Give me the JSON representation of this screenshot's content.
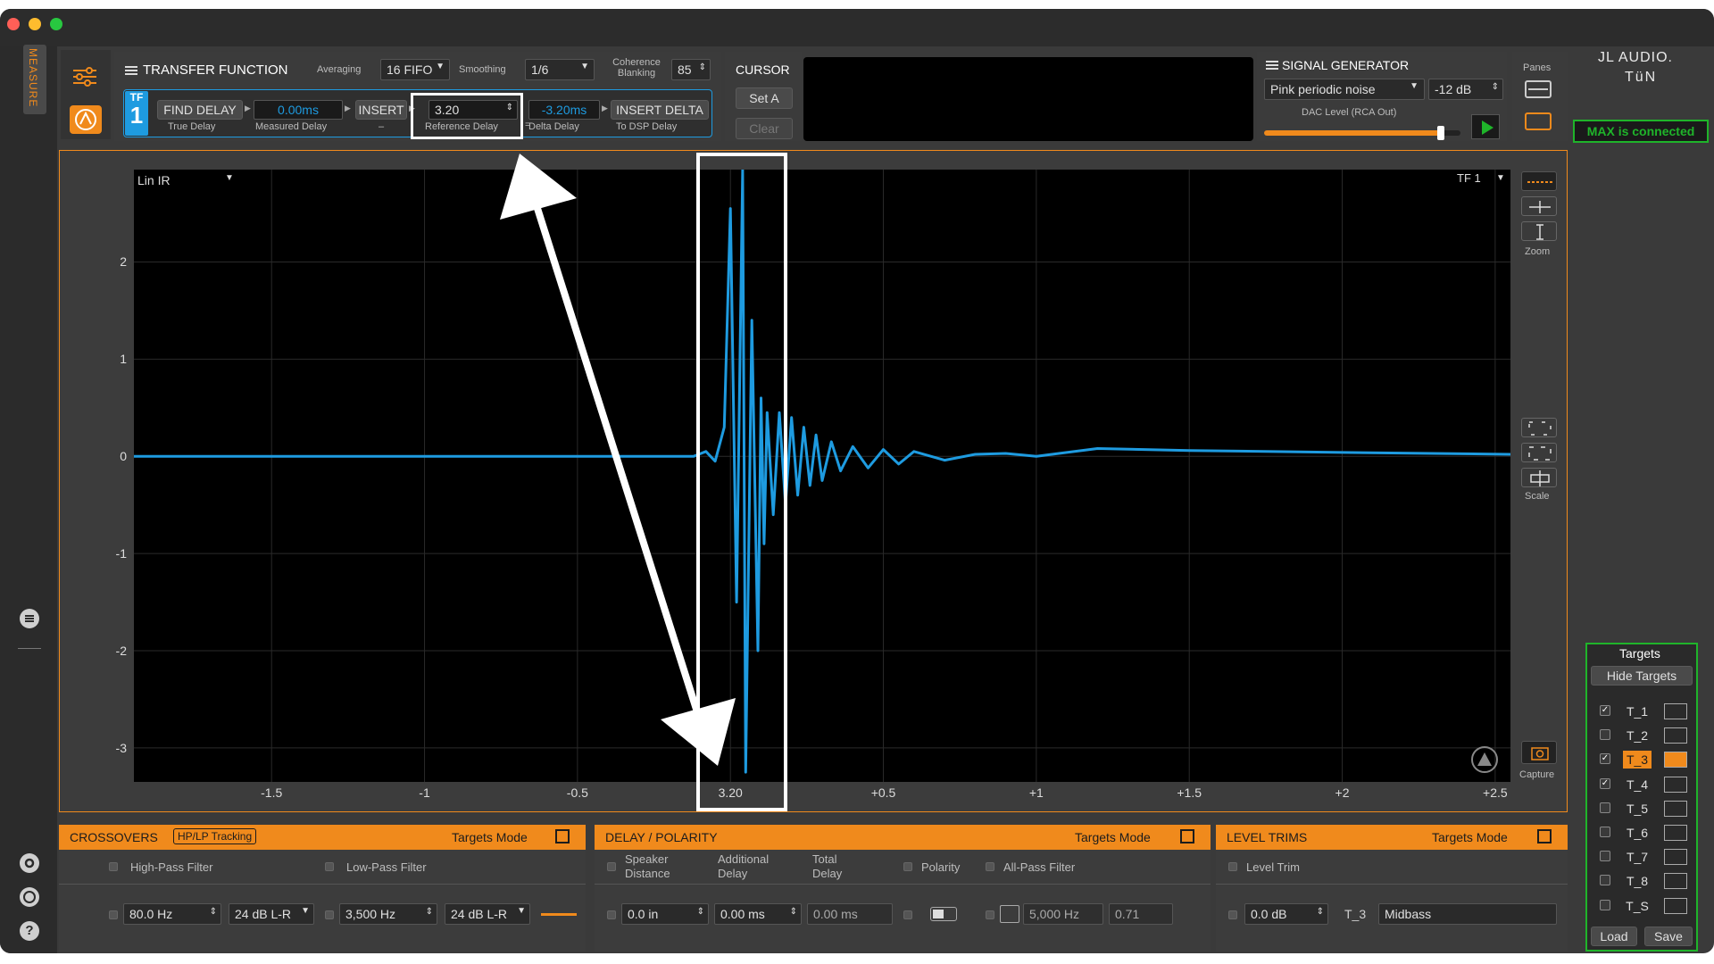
{
  "window": {
    "traffic_lights": {
      "close": "#ff5f57",
      "minimize": "#febc2e",
      "zoom": "#28c840"
    }
  },
  "side_tab": {
    "label": "MEASURE"
  },
  "brand": {
    "line1": "JL AUDIO.",
    "line2": "TüN",
    "status": "MAX is connected",
    "status_color": "#1fb42a"
  },
  "transfer_function": {
    "title": "TRANSFER FUNCTION",
    "averaging_label": "Averaging",
    "averaging_value": "16 FIFO",
    "smoothing_label": "Smoothing",
    "smoothing_value": "1/6",
    "coherence_label_1": "Coherence",
    "coherence_label_2": "Blanking",
    "coherence_value": "85",
    "tf_badge_top": "TF",
    "tf_badge_num": "1",
    "find_delay": "FIND DELAY",
    "true_delay": "True Delay",
    "measured_value": "0.00ms",
    "measured_label": "Measured Delay",
    "insert": "INSERT",
    "insert_sub": "–",
    "reference_value": "3.20",
    "reference_label": "Reference Delay",
    "delta_value": "-3.20ms",
    "delta_label": "Delta Delay",
    "delta_op": "=",
    "insert_delta": "INSERT DELTA",
    "to_dsp": "To DSP Delay"
  },
  "cursor": {
    "title": "CURSOR",
    "set_a": "Set A",
    "clear": "Clear"
  },
  "signal_generator": {
    "title": "SIGNAL GENERATOR",
    "signal": "Pink periodic noise",
    "level": "-12 dB",
    "dac_label": "DAC Level (RCA Out)",
    "dac_level_fraction": 0.9
  },
  "panes": {
    "label": "Panes"
  },
  "plot_tools": {
    "zoom": "Zoom",
    "scale": "Scale",
    "capture": "Capture"
  },
  "accent": {
    "orange": "#f08a1c",
    "blue": "#1e9be0",
    "green": "#1fb42a",
    "highlight": "#ffffff"
  },
  "chart_data": {
    "type": "line",
    "title": "Lin IR",
    "trace_selector": "TF 1",
    "xlabel": "",
    "ylabel": "",
    "xticks": [
      "-1.5",
      "-1",
      "-0.5",
      "3.20",
      "+0.5",
      "+1",
      "+1.5",
      "+2",
      "+2.5"
    ],
    "xtick_values": [
      -1.5,
      -1,
      -0.5,
      0,
      0.5,
      1,
      1.5,
      2,
      2.5
    ],
    "yticks": [
      "2",
      "1",
      "0",
      "-1",
      "-2",
      "-3"
    ],
    "ytick_values": [
      2,
      1,
      0,
      -1,
      -2,
      -3
    ],
    "xlim": [
      -1.95,
      2.55
    ],
    "ylim": [
      -3.35,
      2.95
    ],
    "grid": true,
    "series": [
      {
        "color": "#1e9be0",
        "x": [
          -1.95,
          -1.5,
          -1.0,
          -0.5,
          -0.2,
          -0.12,
          -0.08,
          -0.05,
          -0.02,
          0.0,
          0.02,
          0.04,
          0.05,
          0.07,
          0.09,
          0.1,
          0.11,
          0.12,
          0.14,
          0.16,
          0.18,
          0.2,
          0.22,
          0.24,
          0.26,
          0.28,
          0.3,
          0.33,
          0.36,
          0.4,
          0.45,
          0.5,
          0.55,
          0.6,
          0.7,
          0.8,
          0.9,
          1.0,
          1.2,
          1.5,
          2.0,
          2.55
        ],
        "y": [
          0.0,
          0.0,
          0.0,
          0.0,
          0.0,
          0.0,
          0.05,
          -0.05,
          0.3,
          2.55,
          -1.5,
          2.95,
          -3.25,
          1.4,
          -2.0,
          0.6,
          -0.9,
          0.45,
          -0.6,
          0.45,
          -0.5,
          0.4,
          -0.4,
          0.3,
          -0.3,
          0.22,
          -0.25,
          0.15,
          -0.15,
          0.1,
          -0.12,
          0.07,
          -0.08,
          0.05,
          -0.04,
          0.02,
          0.03,
          0.0,
          0.08,
          0.06,
          0.04,
          0.02
        ]
      }
    ]
  },
  "crossovers": {
    "title": "CROSSOVERS",
    "tracking": "HP/LP Tracking",
    "mode": "Targets Mode",
    "hp_label": "High-Pass Filter",
    "lp_label": "Low-Pass Filter",
    "hp_freq": "80.0 Hz",
    "hp_slope": "24 dB L-R",
    "lp_freq": "3,500 Hz",
    "lp_slope": "24 dB L-R"
  },
  "delay_polarity": {
    "title": "DELAY / POLARITY",
    "mode": "Targets Mode",
    "speaker_1": "Speaker",
    "speaker_2": "Distance",
    "additional_1": "Additional",
    "additional_2": "Delay",
    "total_1": "Total",
    "total_2": "Delay",
    "polarity": "Polarity",
    "allpass": "All-Pass Filter",
    "distance_value": "0.0 in",
    "additional_value": "0.00 ms",
    "total_value": "0.00 ms",
    "ap_freq": "5,000 Hz",
    "ap_q": "0.71"
  },
  "level_trims": {
    "title": "LEVEL TRIMS",
    "mode": "Targets Mode",
    "trim_label": "Level Trim",
    "trim_value": "0.0 dB",
    "target_name": "T_3",
    "target_desc": "Midbass"
  },
  "targets": {
    "title": "Targets",
    "hide": "Hide Targets",
    "items": [
      {
        "name": "T_1",
        "checked": true
      },
      {
        "name": "T_2",
        "checked": false
      },
      {
        "name": "T_3",
        "checked": true,
        "selected": true
      },
      {
        "name": "T_4",
        "checked": true
      },
      {
        "name": "T_5",
        "checked": false
      },
      {
        "name": "T_6",
        "checked": false
      },
      {
        "name": "T_7",
        "checked": false
      },
      {
        "name": "T_8",
        "checked": false
      },
      {
        "name": "T_S",
        "checked": false
      }
    ],
    "load": "Load",
    "save": "Save"
  }
}
